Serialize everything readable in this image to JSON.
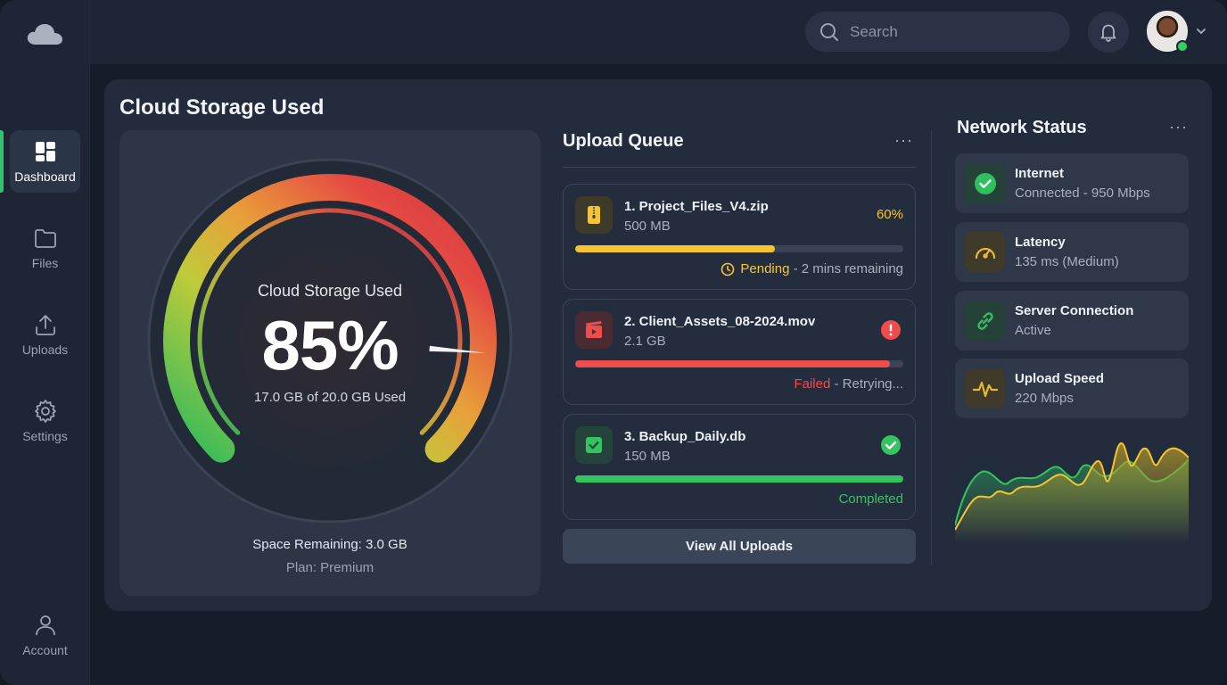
{
  "sidebar": {
    "items": [
      {
        "label": "Dashboard",
        "icon": "dashboard-icon",
        "active": true
      },
      {
        "label": "Files",
        "icon": "folder-icon"
      },
      {
        "label": "Uploads",
        "icon": "upload-icon"
      },
      {
        "label": "Settings",
        "icon": "gear-icon"
      }
    ],
    "account_label": "Account"
  },
  "header": {
    "search_placeholder": "Search"
  },
  "storage": {
    "panel_title": "Cloud Storage Used",
    "gauge_title": "Cloud Storage Used",
    "percent": 85,
    "percent_label": "85%",
    "usage_text": "17.0 GB of 20.0 GB Used",
    "remaining_text": "Space Remaining: 3.0 GB",
    "plan_text": "Plan: Premium"
  },
  "queue": {
    "title": "Upload Queue",
    "menu_label": "···",
    "items": [
      {
        "name": "1. Project_Files_V4.zip",
        "size": "500 MB",
        "right_label": "60%",
        "progress": 0.61,
        "status_word": "Pending",
        "status_rest": " - 2 mins remaining",
        "state": "pending",
        "color": "#f5c531"
      },
      {
        "name": "2. Client_Assets_08-2024.mov",
        "size": "2.1 GB",
        "right_label": "",
        "progress": 0.96,
        "status_word": "Failed",
        "status_rest": " - Retrying...",
        "state": "failed",
        "color": "#ef4c4c"
      },
      {
        "name": "3. Backup_Daily.db",
        "size": "150 MB",
        "right_label": "",
        "progress": 1.0,
        "status_word": "Completed",
        "status_rest": "",
        "state": "completed",
        "color": "#34c45f"
      }
    ],
    "view_all_label": "View All Uploads"
  },
  "network": {
    "title": "Network Status",
    "menu_label": "···",
    "items": [
      {
        "name": "Internet",
        "value": "Connected - 950 Mbps",
        "icon": "check-icon",
        "color": "#2fbf5f"
      },
      {
        "name": "Latency",
        "value": "135 ms (Medium)",
        "icon": "speedometer-icon",
        "color": "#e8b92d"
      },
      {
        "name": "Server Connection",
        "value": "Active",
        "icon": "link-icon",
        "color": "#2fbf5f"
      },
      {
        "name": "Upload Speed",
        "value": "220 Mbps",
        "icon": "pulse-icon",
        "color": "#e8b92d"
      }
    ]
  },
  "colors": {
    "accent_green": "#31c46a",
    "warning_yellow": "#f5c531",
    "error_red": "#ef4c4c"
  }
}
